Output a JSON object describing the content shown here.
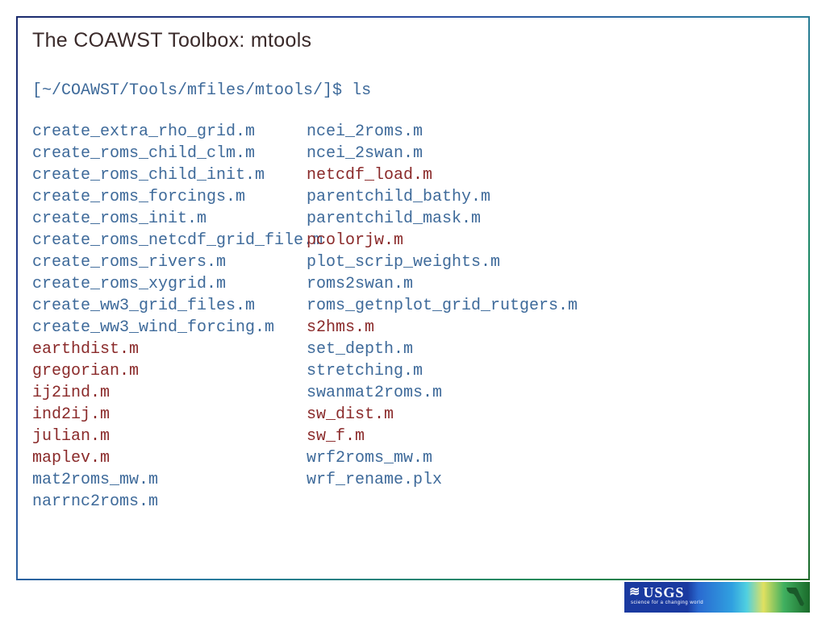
{
  "title": "The COAWST Toolbox: mtools",
  "prompt": "[~/COAWST/Tools/mfiles/mtools/]$ ls",
  "columns": [
    [
      {
        "name": "create_extra_rho_grid.m",
        "color": "blue"
      },
      {
        "name": "create_roms_child_clm.m",
        "color": "blue"
      },
      {
        "name": "create_roms_child_init.m",
        "color": "blue"
      },
      {
        "name": "create_roms_forcings.m",
        "color": "blue"
      },
      {
        "name": "create_roms_init.m",
        "color": "blue"
      },
      {
        "name": "create_roms_netcdf_grid_file.m",
        "color": "blue"
      },
      {
        "name": "create_roms_rivers.m",
        "color": "blue"
      },
      {
        "name": "create_roms_xygrid.m",
        "color": "blue"
      },
      {
        "name": "create_ww3_grid_files.m",
        "color": "blue"
      },
      {
        "name": "create_ww3_wind_forcing.m",
        "color": "blue"
      },
      {
        "name": "earthdist.m",
        "color": "red"
      },
      {
        "name": "gregorian.m",
        "color": "red"
      },
      {
        "name": "ij2ind.m",
        "color": "red"
      },
      {
        "name": "ind2ij.m",
        "color": "red"
      },
      {
        "name": "julian.m",
        "color": "red"
      },
      {
        "name": "maplev.m",
        "color": "red"
      },
      {
        "name": "mat2roms_mw.m",
        "color": "blue"
      },
      {
        "name": "narrnc2roms.m",
        "color": "blue"
      }
    ],
    [
      {
        "name": "ncei_2roms.m",
        "color": "blue"
      },
      {
        "name": "ncei_2swan.m",
        "color": "blue"
      },
      {
        "name": "netcdf_load.m",
        "color": "red"
      },
      {
        "name": "parentchild_bathy.m",
        "color": "blue"
      },
      {
        "name": "parentchild_mask.m",
        "color": "blue"
      },
      {
        "name": "pcolorjw.m",
        "color": "red"
      },
      {
        "name": "plot_scrip_weights.m",
        "color": "blue"
      },
      {
        "name": "roms2swan.m",
        "color": "blue"
      },
      {
        "name": "roms_getnplot_grid_rutgers.m",
        "color": "blue"
      },
      {
        "name": "s2hms.m",
        "color": "red"
      },
      {
        "name": "set_depth.m",
        "color": "blue"
      },
      {
        "name": "stretching.m",
        "color": "blue"
      },
      {
        "name": "swanmat2roms.m",
        "color": "blue"
      },
      {
        "name": "sw_dist.m",
        "color": "red"
      },
      {
        "name": "sw_f.m",
        "color": "red"
      },
      {
        "name": "wrf2roms_mw.m",
        "color": "blue"
      },
      {
        "name": "wrf_rename.plx",
        "color": "blue"
      }
    ]
  ],
  "footer": {
    "usgs": "USGS",
    "tagline": "science for a changing world"
  }
}
